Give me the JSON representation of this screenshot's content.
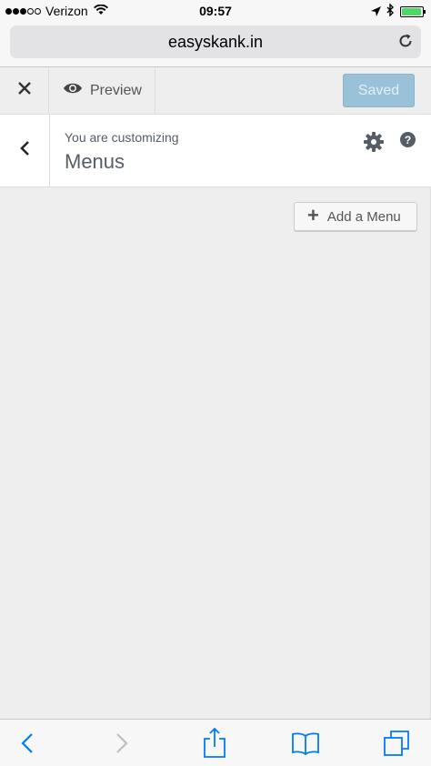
{
  "status_bar": {
    "carrier": "Verizon",
    "time": "09:57",
    "battery_level": 0.95,
    "battery_color": "#4cd964"
  },
  "browser": {
    "url": "easyskank.in",
    "reload_icon": "reload-icon"
  },
  "header": {
    "close_icon": "close-icon",
    "preview_label": "Preview",
    "preview_icon": "eye-icon",
    "saved_label": "Saved"
  },
  "section": {
    "customizing_label": "You are customizing",
    "title": "Menus",
    "back_icon": "chevron-left-icon",
    "settings_icon": "gear-icon",
    "help_icon": "help-icon",
    "help_glyph": "?"
  },
  "content": {
    "add_menu_label": "Add a Menu",
    "add_icon": "plus-icon"
  },
  "toolbar": {
    "items": [
      "back-icon",
      "forward-icon",
      "share-icon",
      "bookmarks-icon",
      "tabs-icon"
    ]
  },
  "colors": {
    "accent_ios": "#007aff",
    "saved_button": "#99c2d8",
    "panel_bg": "#eeeeee"
  }
}
